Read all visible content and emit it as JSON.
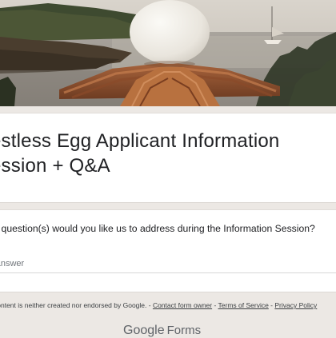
{
  "header": {
    "image_alt": "Egg on a terracotta tile roof overlooking a bay at dusk"
  },
  "form": {
    "title_line1": "estless Egg Applicant Information",
    "title_line2": "ession + Q&A"
  },
  "question": {
    "text": "at question(s) would you like us to address during the Information Session?",
    "placeholder": "r answer"
  },
  "footer": {
    "disclaimer_prefix": "content is neither created nor endorsed by Google. - ",
    "contact_link": "Contact form owner",
    "sep1": " - ",
    "terms_link": "Terms of Service",
    "sep2": " - ",
    "privacy_link": "Privacy Policy",
    "logo_google": "Google",
    "logo_forms": "Forms"
  },
  "colors": {
    "page_background": "#ece8e4",
    "card_background": "#ffffff",
    "text_primary": "#202124",
    "text_secondary": "#5f6368"
  }
}
